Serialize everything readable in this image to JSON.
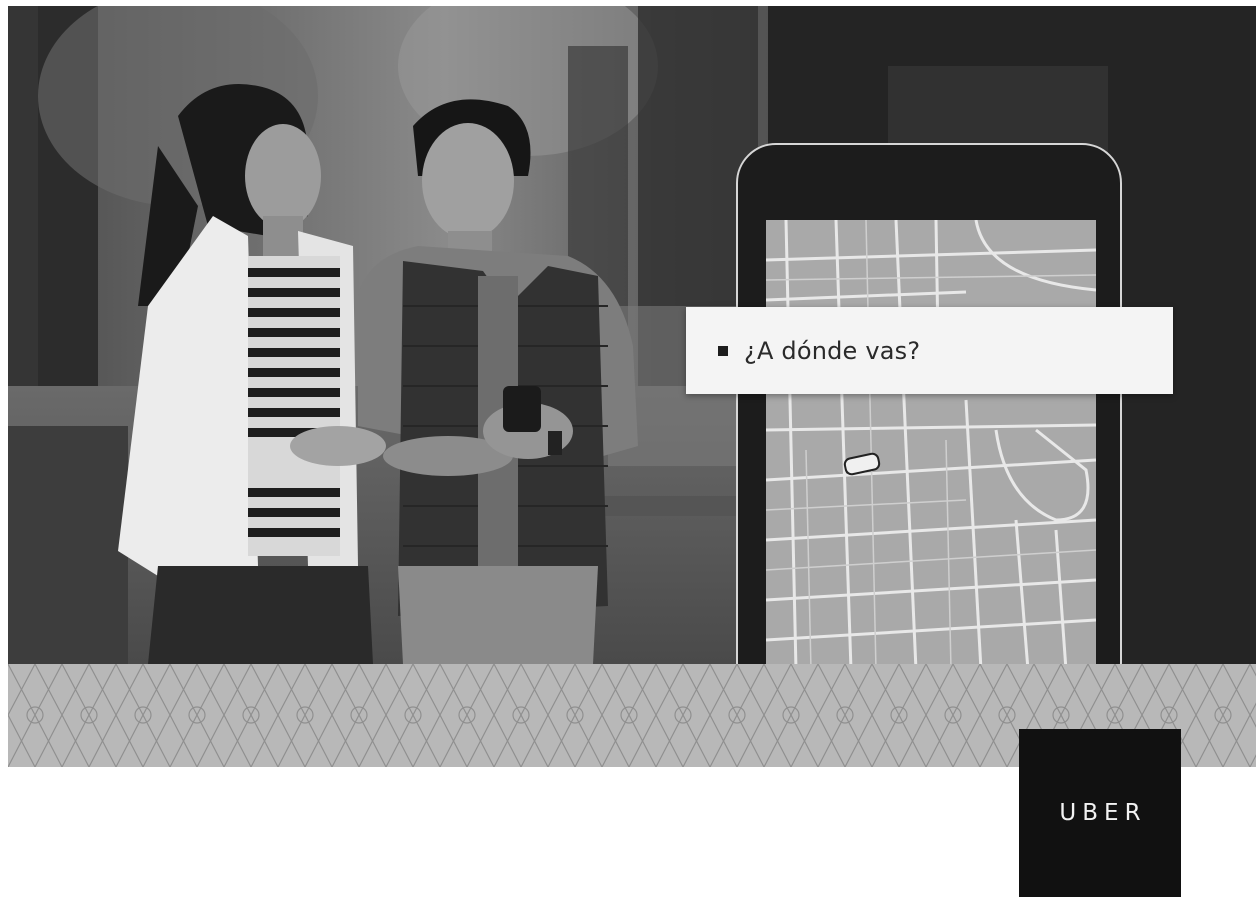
{
  "hero": {
    "photo_description_icon": "couple-walking-photo"
  },
  "app_preview": {
    "search_prompt": "¿A dónde vas?",
    "car_icon": "car-icon"
  },
  "brand": {
    "logo_text": "UBER",
    "logo_bg": "#111111",
    "logo_fg": "#f2f2f2"
  }
}
